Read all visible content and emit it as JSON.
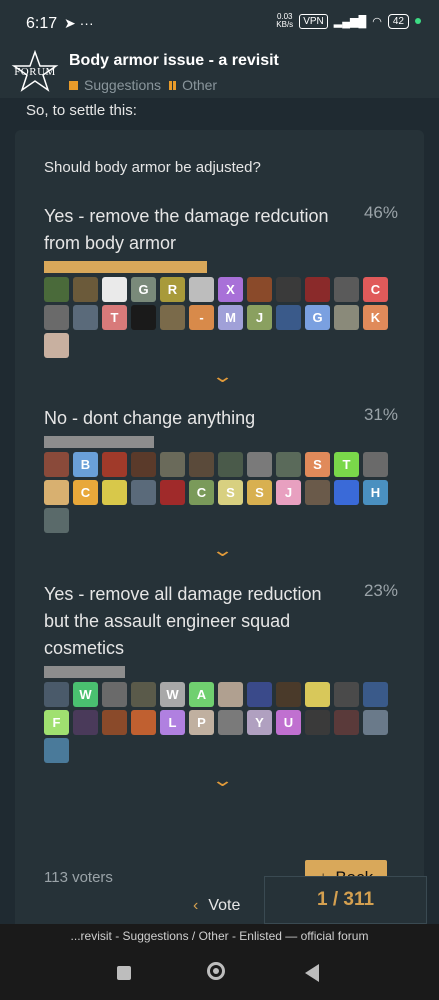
{
  "status": {
    "time": "6:17",
    "net_speed": "0.03\nKB/s",
    "vpn": "VPN",
    "battery": "42"
  },
  "header": {
    "logo_text": "FORUM",
    "title": "Body armor issue - a revisit",
    "crumbs": [
      "Suggestions",
      "Other"
    ]
  },
  "post": {
    "lead": "So, to settle this:"
  },
  "poll": {
    "question": "Should body armor be adjusted?",
    "options": [
      {
        "label": "Yes - remove the damage redcution from body armor",
        "pct": "46%",
        "pct_value": 46,
        "avatars": [
          "",
          "",
          "",
          "G",
          "R",
          "",
          "X",
          "",
          "",
          "",
          "",
          "C",
          "",
          "",
          "T",
          "",
          "",
          "-",
          "M",
          "J",
          "",
          "G",
          "",
          "K",
          ""
        ],
        "colors": [
          "#4a6a3a",
          "#6b5a3a",
          "#eaeaea",
          "#7a8a7a",
          "#a89a3a",
          "#bdbdbd",
          "#a870d8",
          "#8a4a2a",
          "#3a3a3a",
          "#8a2a2a",
          "#5a5a5a",
          "#e05a5a",
          "#6a6a6a",
          "#5a6a7a",
          "#d87a7a",
          "#1a1a1a",
          "#7a6a4a",
          "#d88a4a",
          "#a0a0d8",
          "#8aa060",
          "#3a5a8a",
          "#7aa0e0",
          "#8a8a7a",
          "#e08a5a",
          "#c8b0a0"
        ]
      },
      {
        "label": "No - dont change anything",
        "pct": "31%",
        "pct_value": 31,
        "avatars": [
          "",
          "B",
          "",
          "",
          "",
          "",
          "",
          "",
          "",
          "S",
          "T",
          "",
          "",
          "C",
          "",
          "",
          "",
          "C",
          "S",
          "S",
          "J",
          "",
          "",
          "H",
          ""
        ],
        "colors": [
          "#8a4a3a",
          "#6aa0d8",
          "#a03a2a",
          "#5a3a2a",
          "#6a6a5a",
          "#5a4a3a",
          "#4a5a4a",
          "#7a7a7a",
          "#5a6a5a",
          "#e08a5a",
          "#7ad84a",
          "#6a6a6a",
          "#d8b070",
          "#e8a83a",
          "#d8c84a",
          "#5a6a7a",
          "#a02a2a",
          "#7a9a5a",
          "#d8d080",
          "#d8b050",
          "#e8a0c0",
          "#6a5a4a",
          "#3a6ad8",
          "#4a90c0",
          "#5a6a6a"
        ]
      },
      {
        "label": "Yes - remove all damage reduction but the assault engineer squad cosmetics",
        "pct": "23%",
        "pct_value": 23,
        "avatars": [
          "",
          "W",
          "",
          "",
          "W",
          "A",
          "",
          "",
          "",
          "",
          "",
          "",
          "F",
          "",
          "",
          "",
          "L",
          "P",
          "",
          "Y",
          "U",
          "",
          "",
          "",
          ""
        ],
        "colors": [
          "#4a5a6a",
          "#4ac070",
          "#6a6a6a",
          "#5a5a4a",
          "#a8a8a8",
          "#70d070",
          "#b0a090",
          "#3a4a8a",
          "#4a3a2a",
          "#d8c85a",
          "#4a4a4a",
          "#3a5a8a",
          "#a0e070",
          "#4a3a5a",
          "#8a4a2a",
          "#c06030",
          "#b080e0",
          "#c0b0a0",
          "#7a7a7a",
          "#b0a0c0",
          "#c070d0",
          "#3a3a3a",
          "#5a3a3a",
          "#6a7a8a",
          "#4a7a9a"
        ]
      }
    ],
    "voters": "113 voters",
    "back_label": "Back"
  },
  "nav": {
    "vote_label": "Vote",
    "position": "1 / 311"
  },
  "footer": "...revisit - Suggestions / Other - Enlisted — official forum",
  "colors": {
    "bar_winner": "#d9a85a",
    "bar_other": "#8d8d8d",
    "accent": "#e89b2a"
  }
}
